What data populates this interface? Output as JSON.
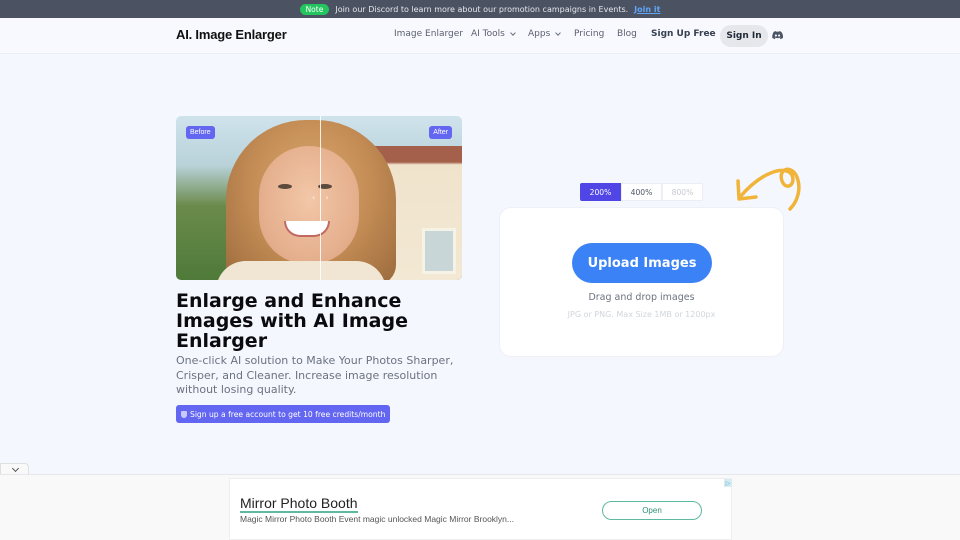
{
  "announcement": {
    "badge": "Note",
    "text": "Join our Discord to learn more about our promotion campaigns in Events.",
    "link": "Join it"
  },
  "nav": {
    "logo": "AI. Image Enlarger",
    "items": [
      {
        "label": "Image Enlarger",
        "dropdown": false
      },
      {
        "label": "AI Tools",
        "dropdown": true
      },
      {
        "label": "Apps",
        "dropdown": true
      },
      {
        "label": "Pricing",
        "dropdown": false
      },
      {
        "label": "Blog",
        "dropdown": false
      }
    ],
    "signup": "Sign Up Free",
    "signin": "Sign In",
    "discord_icon": "discord-icon"
  },
  "hero": {
    "before_label": "Before",
    "after_label": "After",
    "headline": "Enlarge and Enhance Images with AI Image Enlarger",
    "subtext": "One-click AI solution to Make Your Photos Sharper, Crisper, and Cleaner. Increase image resolution without losing quality.",
    "credits_button": "Sign up a free account to get 10 free credits/month"
  },
  "upload": {
    "scales": [
      {
        "label": "200%",
        "state": "active"
      },
      {
        "label": "400%",
        "state": "normal"
      },
      {
        "label": "800%",
        "state": "disabled"
      }
    ],
    "button": "Upload Images",
    "drag_text": "Drag and drop images",
    "limit_text": "JPG or PNG. Max Size 1MB or 1200px"
  },
  "ad": {
    "title": "Mirror Photo Booth",
    "description": "Magic Mirror Photo Booth Event magic unlocked Magic Mirror Brooklyn...",
    "button": "Open"
  },
  "colors": {
    "accent": "#6366f1",
    "upload_button": "#3b82f6",
    "doodle": "#f0b43a",
    "note_badge": "#22c55e"
  }
}
